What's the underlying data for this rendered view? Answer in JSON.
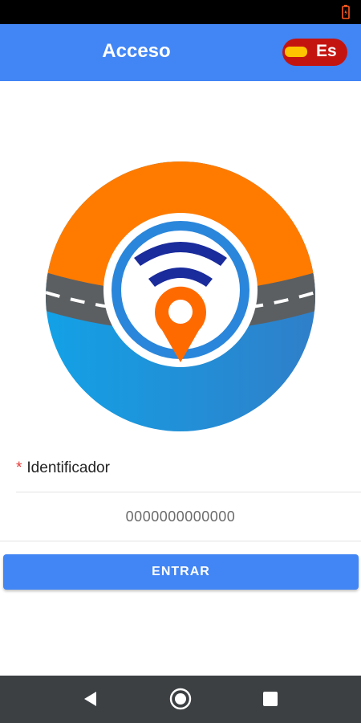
{
  "app_bar": {
    "title": "Acceso",
    "language": "Es"
  },
  "logo": {
    "icon": "road-wifi-location-logo"
  },
  "form": {
    "identifier_label": "Identificador",
    "required_mark": "*",
    "identifier_value": "",
    "identifier_placeholder": "0000000000000"
  },
  "actions": {
    "submit_label": "ENTRAR"
  },
  "colors": {
    "primary": "#4285f4",
    "orange": "#ff7b00",
    "blue": "#1a9be0",
    "dark_blue": "#1a2b9c",
    "required": "#e53935",
    "lang_badge": "#c41410"
  },
  "nav": {
    "icons": [
      "back-icon",
      "home-icon",
      "recents-icon"
    ]
  }
}
